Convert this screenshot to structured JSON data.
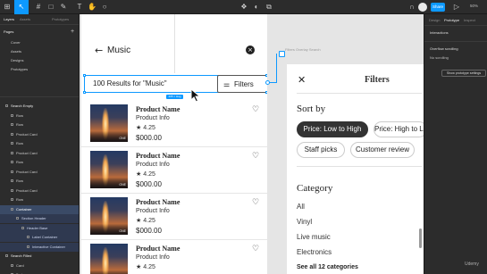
{
  "toolbar": {
    "project_label": "",
    "share_label": "Share",
    "zoom": "50%"
  },
  "left_panel": {
    "tabs": [
      "Layers",
      "Assets",
      "Prototypes"
    ],
    "pages_title": "Pages",
    "pages": [
      "Cover",
      "Assets",
      "Designs",
      "Prototypes"
    ],
    "layers": [
      {
        "label": "Search Empty",
        "level": 0
      },
      {
        "label": "Row",
        "level": 1
      },
      {
        "label": "Row",
        "level": 1
      },
      {
        "label": "Product Card",
        "level": 1
      },
      {
        "label": "Row",
        "level": 1
      },
      {
        "label": "Product Card",
        "level": 1
      },
      {
        "label": "Row",
        "level": 1
      },
      {
        "label": "Product Card",
        "level": 1
      },
      {
        "label": "Row",
        "level": 1
      },
      {
        "label": "Product Card",
        "level": 1
      },
      {
        "label": "Row",
        "level": 1
      },
      {
        "label": "Container",
        "level": 1
      },
      {
        "label": "Section Header",
        "level": 2
      },
      {
        "label": "Header Base",
        "level": 3
      },
      {
        "label": "Label Container",
        "level": 4
      },
      {
        "label": "Interactive Container",
        "level": 4
      },
      {
        "label": "Search Filled",
        "level": 0
      },
      {
        "label": "Card",
        "level": 1
      },
      {
        "label": "Body",
        "level": 1
      }
    ]
  },
  "right_panel": {
    "tabs": [
      "Design",
      "Prototype",
      "Inspect"
    ],
    "interactions_label": "Interactions",
    "overflow_label": "Overflow scrolling",
    "overflow_value": "No scrolling",
    "settings_button": "Show prototype settings"
  },
  "frame": {
    "top_label": "Search Filled",
    "music_title": "Music",
    "results_text": "100 Results for \"Music\"",
    "filters_label": "Filters",
    "size_badge": "205 × Hug"
  },
  "products": [
    {
      "name": "Product Name",
      "info": "Product Info",
      "rating": "4.25",
      "price": "$000.00",
      "badge": "ONE"
    },
    {
      "name": "Product Name",
      "info": "Product Info",
      "rating": "4.25",
      "price": "$000.00",
      "badge": "ONE"
    },
    {
      "name": "Product Name",
      "info": "Product Info",
      "rating": "4.25",
      "price": "$000.00",
      "badge": "ONE"
    },
    {
      "name": "Product Name",
      "info": "Product Info",
      "rating": "4.25",
      "price": "$000.00",
      "badge": "ONE"
    }
  ],
  "overlay": {
    "label": "Filters Overlay Search",
    "title": "Filters",
    "sort_heading": "Sort by",
    "sort_options": [
      "Price: Low to High",
      "Price: High to Low",
      "Staff picks",
      "Customer review"
    ],
    "category_heading": "Category",
    "categories": [
      "All",
      "Vinyl",
      "Live music",
      "Electronics"
    ],
    "see_all": "See all 12 categories"
  },
  "watermark": "Udemy",
  "colors": {
    "accent": "#0d99ff",
    "chip_active": "#333333"
  }
}
